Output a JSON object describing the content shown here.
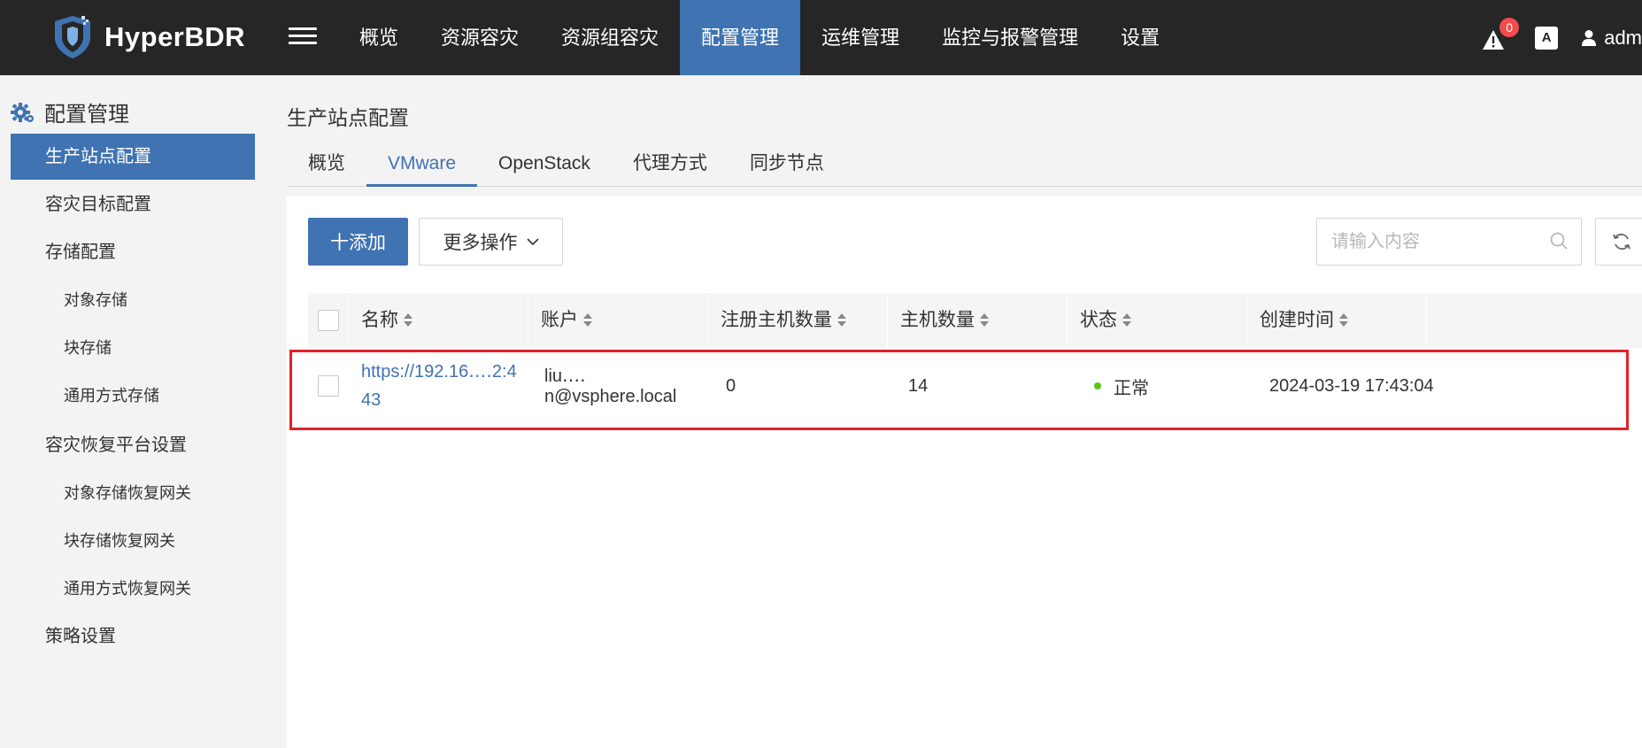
{
  "app": {
    "title": "HyperBDR"
  },
  "nav": {
    "items": [
      "概览",
      "资源容灾",
      "资源组容灾",
      "配置管理",
      "运维管理",
      "监控与报警管理",
      "设置"
    ],
    "active_index": 3
  },
  "header": {
    "alert_count": "0",
    "lang_icon": "A",
    "user": "adm"
  },
  "sidebar": {
    "title": "配置管理",
    "items": [
      {
        "label": "生产站点配置",
        "level": 1,
        "active": true
      },
      {
        "label": "容灾目标配置",
        "level": 1
      },
      {
        "label": "存储配置",
        "level": 1
      },
      {
        "label": "对象存储",
        "level": 2
      },
      {
        "label": "块存储",
        "level": 2
      },
      {
        "label": "通用方式存储",
        "level": 2
      },
      {
        "label": "容灾恢复平台设置",
        "level": 1
      },
      {
        "label": "对象存储恢复网关",
        "level": 2
      },
      {
        "label": "块存储恢复网关",
        "level": 2
      },
      {
        "label": "通用方式恢复网关",
        "level": 2
      },
      {
        "label": "策略设置",
        "level": 1
      }
    ]
  },
  "page": {
    "title": "生产站点配置"
  },
  "tabs": [
    "概览",
    "VMware",
    "OpenStack",
    "代理方式",
    "同步节点"
  ],
  "toolbar": {
    "add_label": "十添加",
    "more_label": "更多操作",
    "search_placeholder": "请输入内容"
  },
  "table": {
    "columns": [
      "名称",
      "账户",
      "注册主机数量",
      "主机数量",
      "状态",
      "创建时间"
    ],
    "rows": [
      {
        "name_line1": "https://192.16‥‥2:4",
        "name_line2": "43",
        "account": "liu‥‥n@vsphere.local",
        "registered_hosts": "0",
        "hosts": "14",
        "status": "正常",
        "created": "2024-03-19 17:43:04"
      }
    ]
  },
  "colors": {
    "accent": "#3f73b2",
    "topbar": "#262626",
    "status_ok": "#52c41a",
    "highlight": "#e5202a"
  }
}
